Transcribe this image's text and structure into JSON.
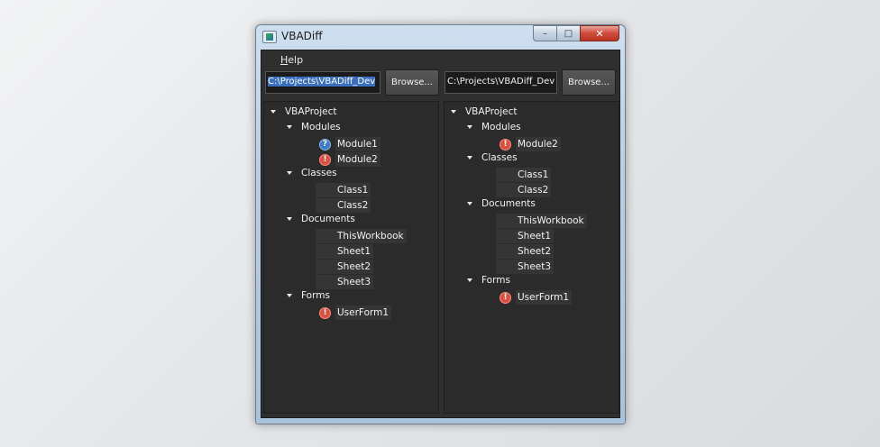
{
  "window": {
    "title": "VBADiff",
    "caption": {
      "minimize": "–",
      "maximize": "□",
      "close": "✕"
    }
  },
  "menu": {
    "help_accel": "H",
    "help_rest": "elp"
  },
  "left": {
    "path": "C:\\Projects\\VBADiff_Dev",
    "browse_label": "Browse...",
    "tree": {
      "root": "VBAProject",
      "modules_label": "Modules",
      "modules": [
        {
          "label": "Module1",
          "status": "info",
          "glyph": "?"
        },
        {
          "label": "Module2",
          "status": "warn",
          "glyph": "!"
        }
      ],
      "classes_label": "Classes",
      "classes": [
        "Class1",
        "Class2"
      ],
      "documents_label": "Documents",
      "documents": [
        "ThisWorkbook",
        "Sheet1",
        "Sheet2",
        "Sheet3"
      ],
      "forms_label": "Forms",
      "forms": [
        {
          "label": "UserForm1",
          "status": "warn",
          "glyph": "!"
        }
      ]
    }
  },
  "right": {
    "path": "C:\\Projects\\VBADiff_Dev",
    "browse_label": "Browse...",
    "tree": {
      "root": "VBAProject",
      "modules_label": "Modules",
      "modules": [
        {
          "label": "Module2",
          "status": "warn",
          "glyph": "!"
        }
      ],
      "classes_label": "Classes",
      "classes": [
        "Class1",
        "Class2"
      ],
      "documents_label": "Documents",
      "documents": [
        "ThisWorkbook",
        "Sheet1",
        "Sheet2",
        "Sheet3"
      ],
      "forms_label": "Forms",
      "forms": [
        {
          "label": "UserForm1",
          "status": "warn",
          "glyph": "!"
        }
      ]
    }
  },
  "colors": {
    "panel_bg": "#2b2b2b",
    "warn": "#d9503f",
    "info": "#3d7cc4",
    "selection": "#3a6fbf"
  }
}
